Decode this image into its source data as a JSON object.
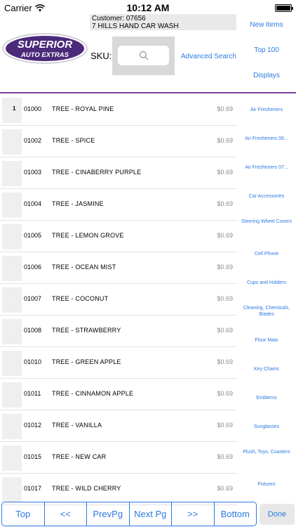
{
  "status_bar": {
    "carrier": "Carrier",
    "time": "10:12 AM"
  },
  "header": {
    "customer_line": "Customer: 07656",
    "customer_name": "7 HILLS HAND CAR WASH",
    "logo_line1": "SUPERIOR",
    "logo_line2": "AUTO EXTRAS",
    "sku_label": "SKU:",
    "advanced_search": "Advanced Search",
    "nav": [
      "New Items",
      "Top 100",
      "Displays"
    ]
  },
  "products": [
    {
      "qty": "1",
      "sku": "01000",
      "name": "TREE - ROYAL PINE",
      "price": "$0.69"
    },
    {
      "qty": "",
      "sku": "01002",
      "name": "TREE - SPICE",
      "price": "$0.69"
    },
    {
      "qty": "",
      "sku": "01003",
      "name": "TREE - CINABERRY PURPLE",
      "price": "$0.69"
    },
    {
      "qty": "",
      "sku": "01004",
      "name": "TREE - JASMINE",
      "price": "$0.69"
    },
    {
      "qty": "",
      "sku": "01005",
      "name": "TREE - LEMON GROVE",
      "price": "$0.69"
    },
    {
      "qty": "",
      "sku": "01006",
      "name": "TREE - OCEAN MIST",
      "price": "$0.69"
    },
    {
      "qty": "",
      "sku": "01007",
      "name": "TREE - COCONUT",
      "price": "$0.69"
    },
    {
      "qty": "",
      "sku": "01008",
      "name": "TREE - STRAWBERRY",
      "price": "$0.69"
    },
    {
      "qty": "",
      "sku": "01010",
      "name": "TREE - GREEN APPLE",
      "price": "$0.69"
    },
    {
      "qty": "",
      "sku": "01011",
      "name": "TREE - CINNAMON APPLE",
      "price": "$0.69"
    },
    {
      "qty": "",
      "sku": "01012",
      "name": "TREE - VANILLA",
      "price": "$0.69"
    },
    {
      "qty": "",
      "sku": "01015",
      "name": "TREE - NEW CAR",
      "price": "$0.69"
    },
    {
      "qty": "",
      "sku": "01017",
      "name": "TREE - WILD CHERRY",
      "price": "$0.69"
    }
  ],
  "categories": [
    "Air Fresheners",
    "Air Fresheners 06...",
    "Air Fresheners 07...",
    "Car Accessories",
    "Steering Wheel Covers",
    "Cell Phone",
    "Cups and Holders",
    "Cleaning, Chemicals, Blades",
    "Floor Mats",
    "Key Chains",
    "Emblems",
    "Sunglasses",
    "Plush, Toys, Coasters",
    "Fixtures"
  ],
  "pager": [
    "Top",
    "<<",
    "PrevPg",
    "Next Pg",
    ">>",
    "Bottom"
  ],
  "done_label": "Done",
  "colors": {
    "accent": "#2c7ae0",
    "divider": "#7b3f98",
    "logo_purple": "#4b2a7a"
  }
}
